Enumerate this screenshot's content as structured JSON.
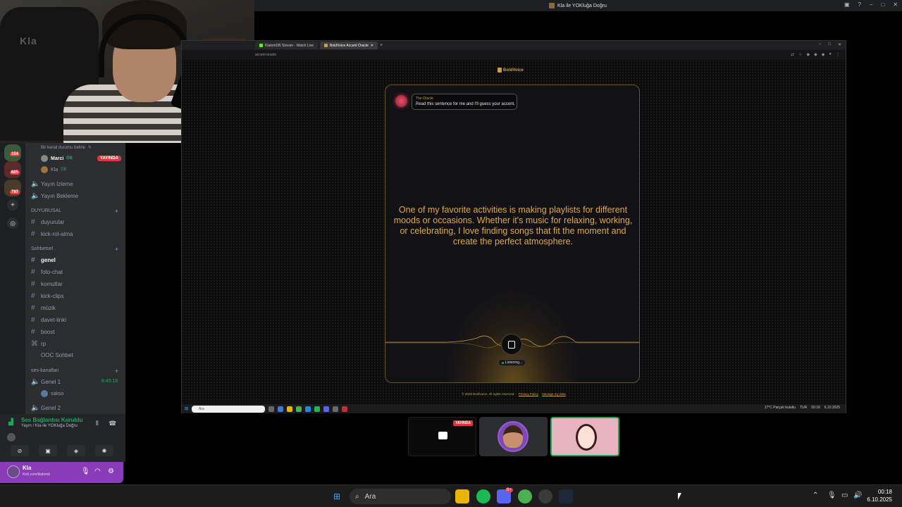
{
  "window": {
    "title": "Kla ile YOKluğa Doğru"
  },
  "webcam": {
    "chair_text": "Kla"
  },
  "sidebar": {
    "server_badges": [
      "154",
      "605",
      "797"
    ],
    "status_line": "Bir kanal durumu belirle",
    "stream_users": [
      {
        "name": "Marci",
        "tag": "DB",
        "live": "YAYINDA"
      },
      {
        "name": "Kla",
        "tag": "DB"
      }
    ],
    "top_channels": [
      "Yayın İzleme",
      "Yayın Bekleme"
    ],
    "categories": {
      "duyurusal": "DUYURUSAL",
      "sohbetsel": "Sohbetsel",
      "ses": "ses-kanalları"
    },
    "duyuru_channels": [
      "duyurular",
      "kick-rol-alma"
    ],
    "sohbet_channels": [
      "genel",
      "foto-chat",
      "komutlar",
      "kick-clips",
      "müzik",
      "davet-linki",
      "boost",
      "rp",
      "OOC Sohbet"
    ],
    "voice_channels": [
      {
        "name": "Genel 1",
        "time": "8:45:16"
      },
      {
        "name": "Genel 2"
      }
    ],
    "voice_user": "sakso",
    "voice_panel": {
      "title": "Ses Bağlantısı Kuruldu",
      "subtitle": "Yayın / Kla ile YOKluğa Doğru"
    },
    "user": {
      "name": "Kla",
      "status": "Kick.com/klatomb"
    }
  },
  "browser": {
    "tabs": [
      {
        "label": "KlatomDB Stream - Watch Live",
        "color": "#53fc18"
      },
      {
        "label": "BoldVoice Accent Oracle",
        "color": "#c8a04a"
      }
    ],
    "url": "accent-oracle",
    "page": {
      "logo": "BoldVoice",
      "oracle_name": "The Oracle",
      "oracle_msg": "Read this sentence for me and I'll guess your accent.",
      "sentence": "One of my favorite activities is making playlists for different moods or occasions. Whether it's music for relaxing, working, or celebrating, I love finding songs that fit the moment and create the perfect atmosphere.",
      "listening": "Listening...",
      "footer_copy": "© 2025 BoldVoice. All rights reserved.",
      "footer_privacy": "Privacy Policy",
      "footer_manage": "Manage my data"
    },
    "inner_taskbar": {
      "search": "Ara",
      "weather": "17°C Parçalı bulutlu",
      "lang": "TUR",
      "time": "00:18",
      "date": "6.10.2025"
    }
  },
  "tiles": {
    "live_label": "YAYINDA"
  },
  "taskbar": {
    "search": "Ara",
    "time": "00:18",
    "date": "6.10.2025",
    "discord_badge": "9+"
  },
  "colors": {
    "accent_gold": "#e0a94a",
    "live_red": "#da373c",
    "online_green": "#23a55a",
    "discord_purple": "#8a3bb8"
  }
}
